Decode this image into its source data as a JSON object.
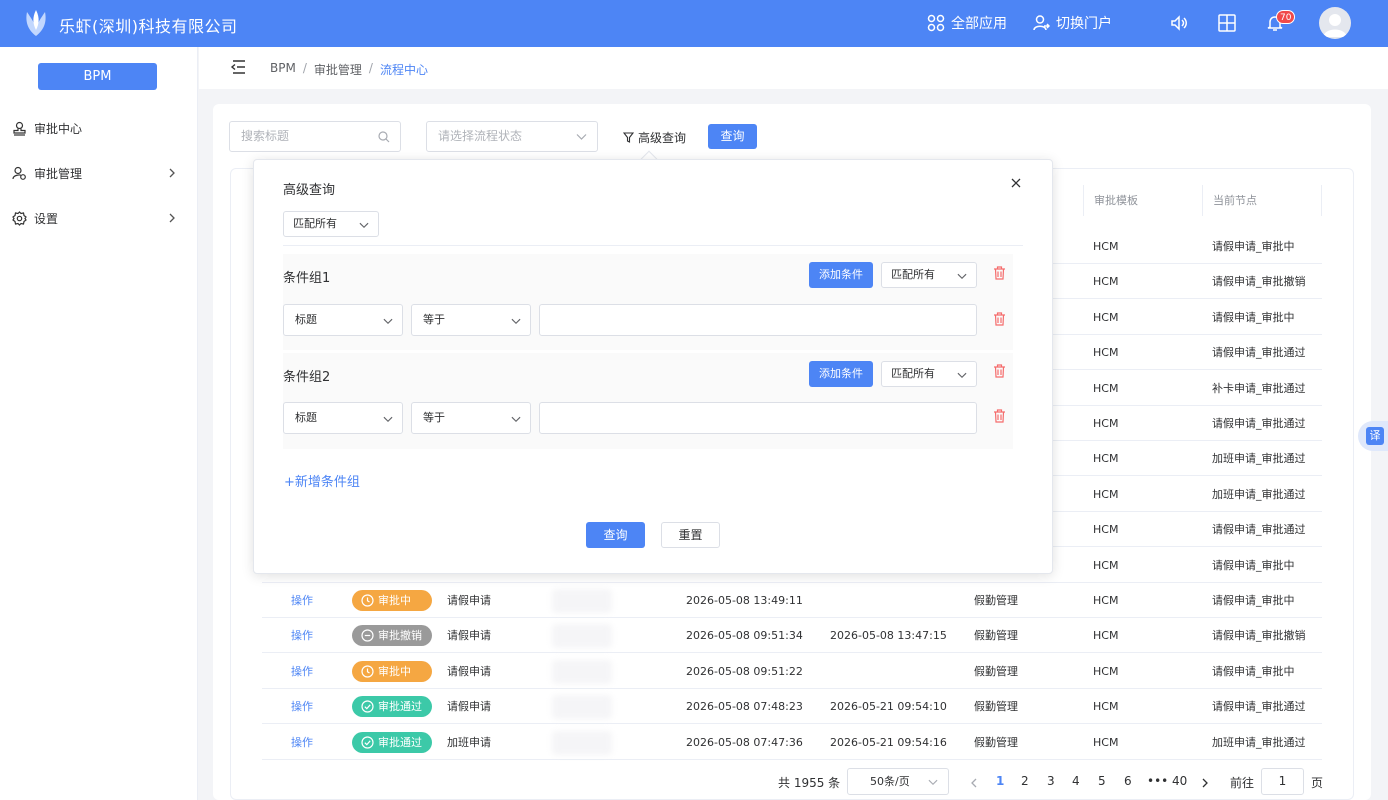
{
  "header": {
    "company": "乐虾(深圳)科技有限公司",
    "all_apps": "全部应用",
    "switch_portal": "切换门户",
    "notification_count": "70",
    "brand_color": "#4d85f5"
  },
  "sidebar": {
    "app_button": "BPM",
    "items": [
      {
        "label": "审批中心",
        "icon": "approve-stamp-icon"
      },
      {
        "label": "审批管理",
        "icon": "user-gear-icon"
      },
      {
        "label": "设置",
        "icon": "gear-icon"
      }
    ]
  },
  "breadcrumb": [
    "BPM",
    "审批管理",
    "流程中心"
  ],
  "search": {
    "title_placeholder": "搜索标题",
    "status_placeholder": "请选择流程状态",
    "advanced_label": "高级查询",
    "query_button": "查询"
  },
  "table": {
    "headers": [
      "审批模板",
      "当前节点"
    ],
    "upper_rows": [
      {
        "template": "HCM",
        "node": "请假申请_审批中"
      },
      {
        "template": "HCM",
        "node": "请假申请_审批撤销"
      },
      {
        "template": "HCM",
        "node": "请假申请_审批中"
      },
      {
        "template": "HCM",
        "node": "请假申请_审批通过"
      },
      {
        "template": "HCM",
        "node": "补卡申请_审批通过"
      },
      {
        "template": "HCM",
        "node": "请假申请_审批通过"
      },
      {
        "template": "HCM",
        "node": "加班申请_审批通过"
      },
      {
        "template": "HCM",
        "node": "加班申请_审批通过"
      },
      {
        "template": "HCM",
        "node": "请假申请_审批通过"
      },
      {
        "template": "HCM",
        "node": "请假申请_审批中"
      }
    ],
    "rows": [
      {
        "op": "操作",
        "status": "审批中",
        "status_type": "pending",
        "type": "请假申请",
        "start": "2026-05-08 13:49:11",
        "end": "",
        "category": "假勤管理",
        "template": "HCM",
        "node": "请假申请_审批中"
      },
      {
        "op": "操作",
        "status": "审批撤销",
        "status_type": "revoked",
        "type": "请假申请",
        "start": "2026-05-08 09:51:34",
        "end": "2026-05-08 13:47:15",
        "category": "假勤管理",
        "template": "HCM",
        "node": "请假申请_审批撤销"
      },
      {
        "op": "操作",
        "status": "审批中",
        "status_type": "pending",
        "type": "请假申请",
        "start": "2026-05-08 09:51:22",
        "end": "",
        "category": "假勤管理",
        "template": "HCM",
        "node": "请假申请_审批中"
      },
      {
        "op": "操作",
        "status": "审批通过",
        "status_type": "approved",
        "type": "请假申请",
        "start": "2026-05-08 07:48:23",
        "end": "2026-05-21 09:54:10",
        "category": "假勤管理",
        "template": "HCM",
        "node": "请假申请_审批通过"
      },
      {
        "op": "操作",
        "status": "审批通过",
        "status_type": "approved",
        "type": "加班申请",
        "start": "2026-05-08 07:47:36",
        "end": "2026-05-21 09:54:16",
        "category": "假勤管理",
        "template": "HCM",
        "node": "加班申请_审批通过"
      }
    ],
    "status_colors": {
      "pending": "#f5a742",
      "revoked": "#9a9a9a",
      "approved": "#3cc9a8"
    }
  },
  "pagination": {
    "total": "共 1955 条",
    "page_size": "50条/页",
    "pages": [
      "1",
      "2",
      "3",
      "4",
      "5",
      "6",
      "•••",
      "40"
    ],
    "current": "1",
    "goto_prefix": "前往",
    "goto_value": "1",
    "goto_suffix": "页"
  },
  "advanced_query": {
    "title": "高级查询",
    "match_mode": "匹配所有",
    "groups": [
      {
        "title": "条件组1",
        "add_condition": "添加条件",
        "match": "匹配所有",
        "field": "标题",
        "operator": "等于",
        "value": ""
      },
      {
        "title": "条件组2",
        "add_condition": "添加条件",
        "match": "匹配所有",
        "field": "标题",
        "operator": "等于",
        "value": ""
      }
    ],
    "add_group": "+新增条件组",
    "query_button": "查询",
    "reset_button": "重置"
  },
  "translate_label": "译"
}
